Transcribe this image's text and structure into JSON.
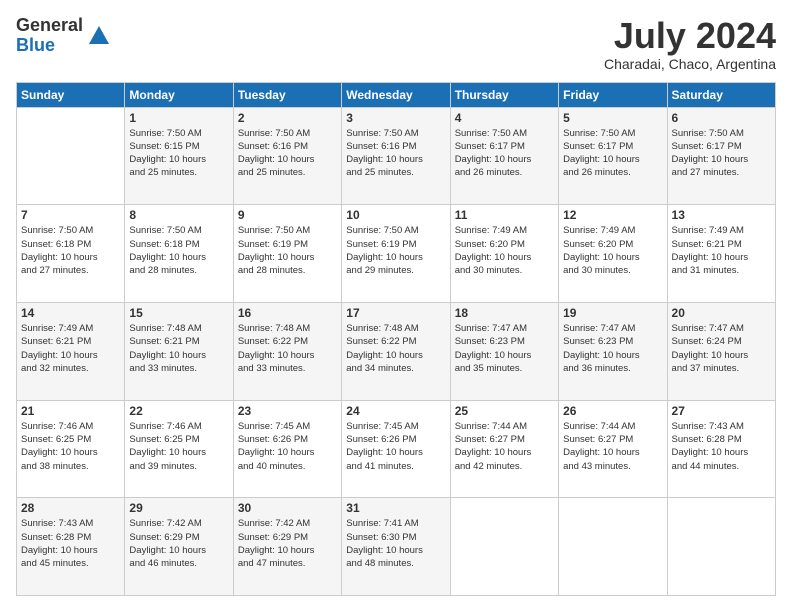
{
  "logo": {
    "general": "General",
    "blue": "Blue"
  },
  "title": "July 2024",
  "location": "Charadai, Chaco, Argentina",
  "days_of_week": [
    "Sunday",
    "Monday",
    "Tuesday",
    "Wednesday",
    "Thursday",
    "Friday",
    "Saturday"
  ],
  "weeks": [
    [
      {
        "day": "",
        "info": ""
      },
      {
        "day": "1",
        "info": "Sunrise: 7:50 AM\nSunset: 6:15 PM\nDaylight: 10 hours\nand 25 minutes."
      },
      {
        "day": "2",
        "info": "Sunrise: 7:50 AM\nSunset: 6:16 PM\nDaylight: 10 hours\nand 25 minutes."
      },
      {
        "day": "3",
        "info": "Sunrise: 7:50 AM\nSunset: 6:16 PM\nDaylight: 10 hours\nand 25 minutes."
      },
      {
        "day": "4",
        "info": "Sunrise: 7:50 AM\nSunset: 6:17 PM\nDaylight: 10 hours\nand 26 minutes."
      },
      {
        "day": "5",
        "info": "Sunrise: 7:50 AM\nSunset: 6:17 PM\nDaylight: 10 hours\nand 26 minutes."
      },
      {
        "day": "6",
        "info": "Sunrise: 7:50 AM\nSunset: 6:17 PM\nDaylight: 10 hours\nand 27 minutes."
      }
    ],
    [
      {
        "day": "7",
        "info": "Sunrise: 7:50 AM\nSunset: 6:18 PM\nDaylight: 10 hours\nand 27 minutes."
      },
      {
        "day": "8",
        "info": "Sunrise: 7:50 AM\nSunset: 6:18 PM\nDaylight: 10 hours\nand 28 minutes."
      },
      {
        "day": "9",
        "info": "Sunrise: 7:50 AM\nSunset: 6:19 PM\nDaylight: 10 hours\nand 28 minutes."
      },
      {
        "day": "10",
        "info": "Sunrise: 7:50 AM\nSunset: 6:19 PM\nDaylight: 10 hours\nand 29 minutes."
      },
      {
        "day": "11",
        "info": "Sunrise: 7:49 AM\nSunset: 6:20 PM\nDaylight: 10 hours\nand 30 minutes."
      },
      {
        "day": "12",
        "info": "Sunrise: 7:49 AM\nSunset: 6:20 PM\nDaylight: 10 hours\nand 30 minutes."
      },
      {
        "day": "13",
        "info": "Sunrise: 7:49 AM\nSunset: 6:21 PM\nDaylight: 10 hours\nand 31 minutes."
      }
    ],
    [
      {
        "day": "14",
        "info": "Sunrise: 7:49 AM\nSunset: 6:21 PM\nDaylight: 10 hours\nand 32 minutes."
      },
      {
        "day": "15",
        "info": "Sunrise: 7:48 AM\nSunset: 6:21 PM\nDaylight: 10 hours\nand 33 minutes."
      },
      {
        "day": "16",
        "info": "Sunrise: 7:48 AM\nSunset: 6:22 PM\nDaylight: 10 hours\nand 33 minutes."
      },
      {
        "day": "17",
        "info": "Sunrise: 7:48 AM\nSunset: 6:22 PM\nDaylight: 10 hours\nand 34 minutes."
      },
      {
        "day": "18",
        "info": "Sunrise: 7:47 AM\nSunset: 6:23 PM\nDaylight: 10 hours\nand 35 minutes."
      },
      {
        "day": "19",
        "info": "Sunrise: 7:47 AM\nSunset: 6:23 PM\nDaylight: 10 hours\nand 36 minutes."
      },
      {
        "day": "20",
        "info": "Sunrise: 7:47 AM\nSunset: 6:24 PM\nDaylight: 10 hours\nand 37 minutes."
      }
    ],
    [
      {
        "day": "21",
        "info": "Sunrise: 7:46 AM\nSunset: 6:25 PM\nDaylight: 10 hours\nand 38 minutes."
      },
      {
        "day": "22",
        "info": "Sunrise: 7:46 AM\nSunset: 6:25 PM\nDaylight: 10 hours\nand 39 minutes."
      },
      {
        "day": "23",
        "info": "Sunrise: 7:45 AM\nSunset: 6:26 PM\nDaylight: 10 hours\nand 40 minutes."
      },
      {
        "day": "24",
        "info": "Sunrise: 7:45 AM\nSunset: 6:26 PM\nDaylight: 10 hours\nand 41 minutes."
      },
      {
        "day": "25",
        "info": "Sunrise: 7:44 AM\nSunset: 6:27 PM\nDaylight: 10 hours\nand 42 minutes."
      },
      {
        "day": "26",
        "info": "Sunrise: 7:44 AM\nSunset: 6:27 PM\nDaylight: 10 hours\nand 43 minutes."
      },
      {
        "day": "27",
        "info": "Sunrise: 7:43 AM\nSunset: 6:28 PM\nDaylight: 10 hours\nand 44 minutes."
      }
    ],
    [
      {
        "day": "28",
        "info": "Sunrise: 7:43 AM\nSunset: 6:28 PM\nDaylight: 10 hours\nand 45 minutes."
      },
      {
        "day": "29",
        "info": "Sunrise: 7:42 AM\nSunset: 6:29 PM\nDaylight: 10 hours\nand 46 minutes."
      },
      {
        "day": "30",
        "info": "Sunrise: 7:42 AM\nSunset: 6:29 PM\nDaylight: 10 hours\nand 47 minutes."
      },
      {
        "day": "31",
        "info": "Sunrise: 7:41 AM\nSunset: 6:30 PM\nDaylight: 10 hours\nand 48 minutes."
      },
      {
        "day": "",
        "info": ""
      },
      {
        "day": "",
        "info": ""
      },
      {
        "day": "",
        "info": ""
      }
    ]
  ]
}
